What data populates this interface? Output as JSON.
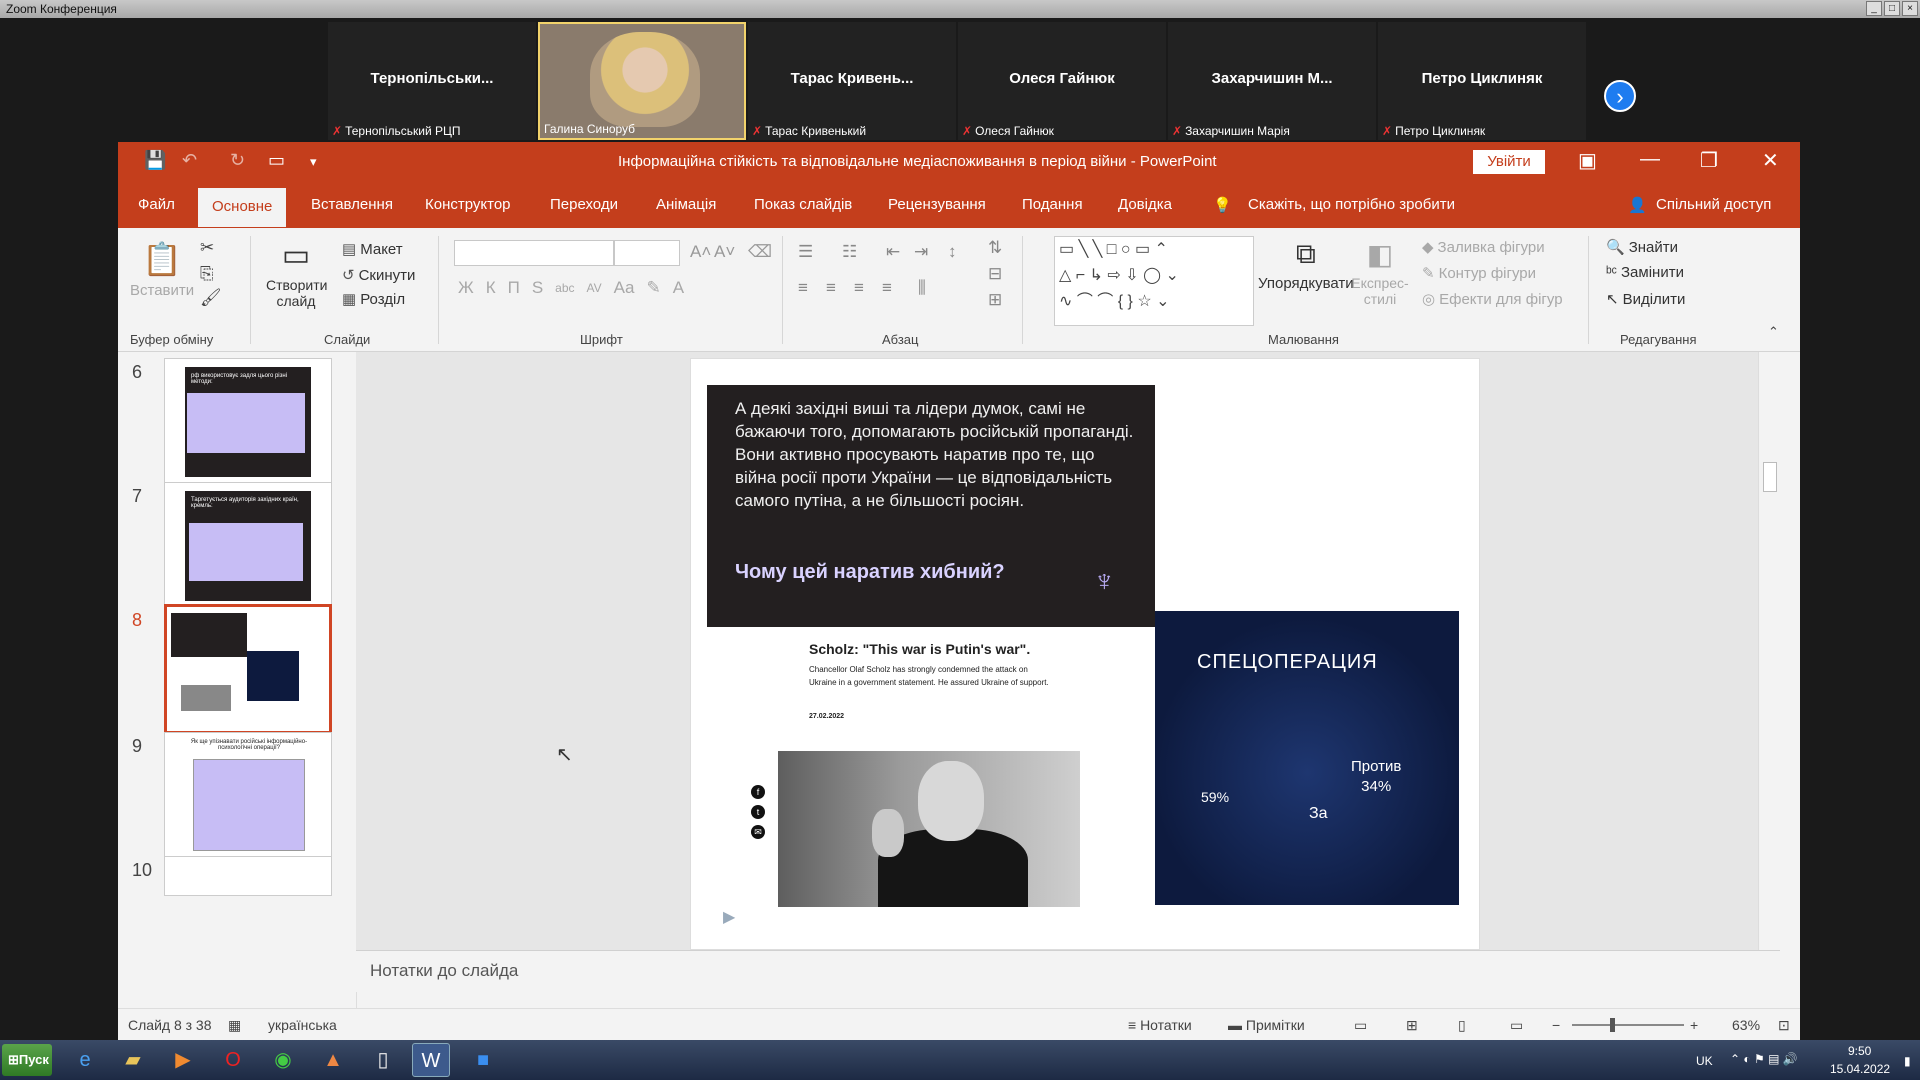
{
  "zoom": {
    "window_title": "Zoom Конференция",
    "participants": [
      {
        "display": "Тернопільськи...",
        "label": "Тернопільський РЦП"
      },
      {
        "display": "",
        "label": "Галина Синоруб"
      },
      {
        "display": "Тарас Кривень...",
        "label": "Тарас Кривенький"
      },
      {
        "display": "Олеся Гайнюк",
        "label": "Олеся Гайнюк"
      },
      {
        "display": "Захарчишин М...",
        "label": "Захарчишин Марія"
      },
      {
        "display": "Петро Циклиняк",
        "label": "Петро Циклиняк"
      }
    ],
    "next_icon": "chevron-right-icon"
  },
  "ppt": {
    "title": "Інформаційна стійкість та відповідальне медіаспоживання в період війни  -  PowerPoint",
    "login": "Увійти",
    "tabs": [
      "Файл",
      "Основне",
      "Вставлення",
      "Конструктор",
      "Переходи",
      "Анімація",
      "Показ слайдів",
      "Рецензування",
      "Подання",
      "Довідка"
    ],
    "tell_me": "Скажіть, що потрібно зробити",
    "share": "Спільний доступ",
    "ribbon": {
      "paste": "Вставити",
      "clipboard": "Буфер обміну",
      "new_slide": "Створити слайд",
      "layout": "Макет",
      "reset": "Скинути",
      "section": "Розділ",
      "slides": "Слайди",
      "font": "Шрифт",
      "font_btns": [
        "Ж",
        "К",
        "П",
        "S",
        "abc",
        "AV",
        "Aa"
      ],
      "paragraph": "Абзац",
      "arrange": "Упорядкувати",
      "quick_styles": "Експрес-стилі",
      "shape_fill": "Заливка фігури",
      "shape_outline": "Контур фігури",
      "shape_effects": "Ефекти для фігур",
      "drawing": "Малювання",
      "find": "Знайти",
      "replace": "Замінити",
      "select": "Виділити",
      "editing": "Редагування"
    },
    "thumbnails": [
      {
        "num": "6",
        "title": "рф використовує задля цього різні методи:"
      },
      {
        "num": "7",
        "title": "Таргетується аудиторія західних країн, кремль:"
      },
      {
        "num": "8",
        "title": ""
      },
      {
        "num": "9",
        "title": "Як ще упізнавати російські інформаційно-психологічні операції?"
      },
      {
        "num": "10",
        "title": ""
      }
    ],
    "slide": {
      "dark_text": "А деякі західні виші та лідери думок, самі не бажаючи того, допомагають російській пропаганді. Вони активно просувають наратив про те, що війна росії проти України — це відповідальність самого путіна, а не більшості росіян.",
      "question": "Чому цей наратив хибний?",
      "scholz_headline": "Scholz: \"This war is Putin's war\".",
      "scholz_body": "Chancellor Olaf Scholz has strongly condemned the attack on Ukraine in a government statement. He assured Ukraine of support.",
      "scholz_date": "27.02.2022",
      "cartoon_title": "СПЕЦОПЕРАЦИЯ",
      "cartoon_against": "Против\n34%",
      "cartoon_pct": "59%",
      "cartoon_for": "За"
    },
    "notes_placeholder": "Нотатки до слайда",
    "status": {
      "slide": "Слайд 8 з 38",
      "lang": "українська",
      "notes": "Нотатки",
      "comments": "Примітки",
      "zoom": "63%"
    }
  },
  "taskbar": {
    "start": "Пуск",
    "lang": "UK",
    "time": "9:50",
    "date": "15.04.2022"
  }
}
